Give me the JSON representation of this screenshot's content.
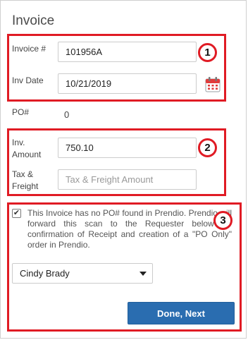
{
  "page": {
    "title": "Invoice"
  },
  "invoice": {
    "number_label": "Invoice #",
    "number_value": "101956A",
    "date_label": "Inv Date",
    "date_value": "10/21/2019",
    "po_label": "PO#",
    "po_value": "0"
  },
  "amounts": {
    "amount_label_line1": "Inv.",
    "amount_label_line2": "Amount",
    "amount_value": "750.10",
    "tax_label_line1": "Tax &",
    "tax_label_line2": "Freight",
    "tax_placeholder": "Tax & Freight Amount"
  },
  "forward": {
    "checked": true,
    "message": "This Invoice has no PO# found in Prendio. Prendio will forward this scan to the Requester below for confirmation of Receipt and creation of a \"PO Only\" order in Prendio.",
    "requester_selected": "Cindy Brady",
    "submit_label": "Done, Next"
  },
  "annotations": {
    "badge1": "1",
    "badge2": "2",
    "badge3": "3"
  },
  "colors": {
    "annotation_red": "#e01b24",
    "primary_button": "#2a6db0"
  },
  "icons": {
    "date_picker": "calendar-icon",
    "select": "chevron-down-icon",
    "checkbox": "checkmark-icon"
  }
}
